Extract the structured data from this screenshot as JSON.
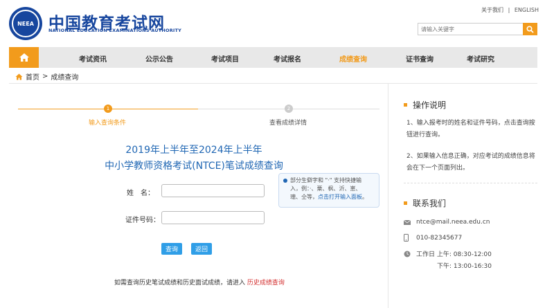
{
  "header": {
    "logo_text": "NEEA",
    "brand_cn": "中国教育考试网",
    "brand_en": "NATIONAL EDUCATION EXAMINATIONS AUTHORITY",
    "toplinks": [
      "关于我们",
      "ENGLISH"
    ],
    "toplink_sep": "|",
    "search_placeholder": "请输入关键字"
  },
  "nav": {
    "items": [
      "考试资讯",
      "公示公告",
      "考试项目",
      "考试报名",
      "成绩查询",
      "证书查询",
      "考试研究"
    ],
    "active_index": 4
  },
  "breadcrumb": {
    "home": "首页",
    "sep": ">",
    "current": "成绩查询"
  },
  "steps": [
    {
      "num": "1",
      "label": "输入查询条件",
      "active": true
    },
    {
      "num": "2",
      "label": "查看成绩详情",
      "active": false
    }
  ],
  "form": {
    "title_line1": "2019年上半年至2024年上半年",
    "title_line2": "中小学教师资格考试(NTCE)笔试成绩查询",
    "name_label": "姓　名：",
    "id_label": "证件号码：",
    "name_value": "",
    "id_value": "",
    "tip_line1": "部分生僻字和 \"·\" 支持快捷输",
    "tip_line2": "入，例：·、粟、枫、沂、崽、",
    "tip_line3_text": "璁、仝等，",
    "tip_line3_link": "点击打开输入面板",
    "tip_line3_end": "。",
    "query_button": "查询",
    "back_button": "返回",
    "history_text": "如需查询历史笔试成绩和历史面试成绩，请进入",
    "history_link": "历史成绩查询"
  },
  "sidebar": {
    "guide_title": "操作说明",
    "guide_items": [
      "1、输入报考时的姓名和证件号码，点击查询按钮进行查询。",
      "2、如果输入信息正确，对应考试的成绩信息将会在下一个页面列出。"
    ],
    "contact_title": "联系我们",
    "email": "ntce@mail.neea.edu.cn",
    "phone": "010-82345677",
    "hours_am": "工作日 上午:  08:30-12:00",
    "hours_pm": "下午:  13:00-16:30"
  },
  "colors": {
    "brand": "#17469e",
    "accent": "#f29b1c",
    "link": "#1f66b3"
  }
}
